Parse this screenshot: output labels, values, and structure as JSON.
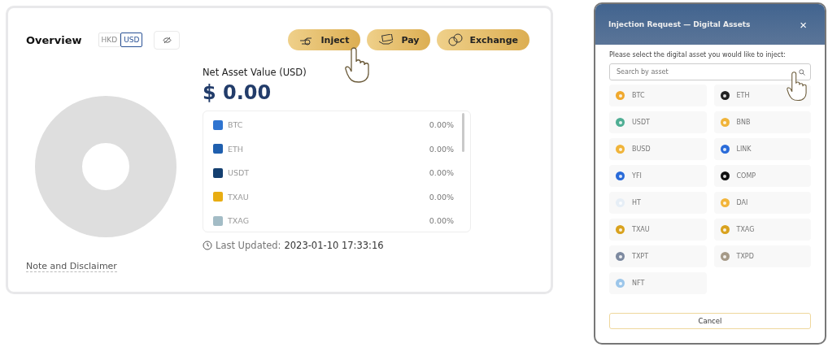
{
  "overview": {
    "title": "Overview",
    "currencies": [
      {
        "label": "HKD",
        "selected": false
      },
      {
        "label": "USD",
        "selected": true
      }
    ],
    "actions": [
      {
        "label": "Inject",
        "kind": "inject"
      },
      {
        "label": "Pay",
        "kind": "pay"
      },
      {
        "label": "Exchange",
        "kind": "exchange"
      }
    ],
    "nav_label": "Net Asset Value (USD)",
    "nav_value": "$ 0.00",
    "legend": [
      {
        "name": "BTC",
        "value": "0.00%",
        "color": "#2f74d0"
      },
      {
        "name": "ETH",
        "value": "0.00%",
        "color": "#1f5fae"
      },
      {
        "name": "USDT",
        "value": "0.00%",
        "color": "#143f70"
      },
      {
        "name": "TXAU",
        "value": "0.00%",
        "color": "#e8ad12"
      },
      {
        "name": "TXAG",
        "value": "0.00%",
        "color": "#a3bcc6"
      }
    ],
    "last_updated_label": "Last Updated:",
    "last_updated": "2023-01-10 17:33:16",
    "note_link": "Note and Disclaimer"
  },
  "dialog": {
    "title": "Injection Request — Digital Assets",
    "close": "×",
    "prompt": "Please select the digital asset you would like to inject:",
    "search": {
      "placeholder": "Search by asset"
    },
    "assets": [
      {
        "name": "BTC",
        "color": "#f0a92e"
      },
      {
        "name": "ETH",
        "color": "#222222"
      },
      {
        "name": "USDT",
        "color": "#4fae94"
      },
      {
        "name": "BNB",
        "color": "#f0b43a"
      },
      {
        "name": "BUSD",
        "color": "#f0b43a"
      },
      {
        "name": "LINK",
        "color": "#2a6bd9"
      },
      {
        "name": "YFI",
        "color": "#2a6bd9"
      },
      {
        "name": "COMP",
        "color": "#111111"
      },
      {
        "name": "HT",
        "color": "#e6eef6"
      },
      {
        "name": "DAI",
        "color": "#f2b53b"
      },
      {
        "name": "TXAU",
        "color": "#d9a21e"
      },
      {
        "name": "TXAG",
        "color": "#d9a21e"
      },
      {
        "name": "TXPT",
        "color": "#7d8aa0"
      },
      {
        "name": "TXPD",
        "color": "#a69a88"
      },
      {
        "name": "NFT",
        "color": "#9cc6ea"
      }
    ],
    "cancel": "Cancel"
  }
}
